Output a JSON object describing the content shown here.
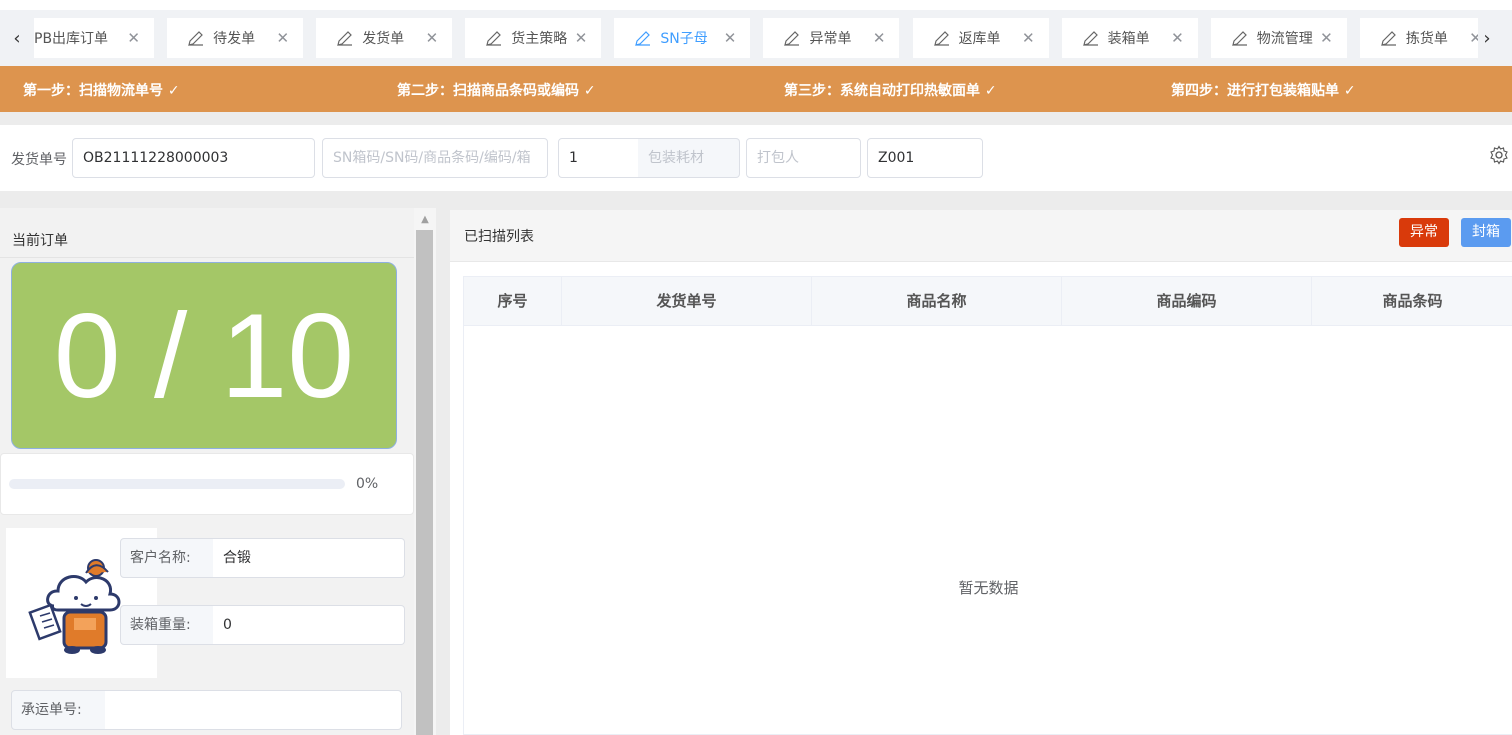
{
  "tabs": [
    {
      "label": "PB出库订单",
      "active": false
    },
    {
      "label": "待发单",
      "active": false
    },
    {
      "label": "发货单",
      "active": false
    },
    {
      "label": "货主策略",
      "active": false
    },
    {
      "label": "SN子母",
      "active": true
    },
    {
      "label": "异常单",
      "active": false
    },
    {
      "label": "返库单",
      "active": false
    },
    {
      "label": "装箱单",
      "active": false
    },
    {
      "label": "物流管理",
      "active": false
    },
    {
      "label": "拣货单",
      "active": false
    }
  ],
  "steps": [
    "第一步：扫描物流单号 ✓",
    "第二步：扫描商品条码或编码 ✓",
    "第三步：系统自动打印热敏面单 ✓",
    "第四步：进行打包装箱贴单 ✓"
  ],
  "form": {
    "order_label": "发货单号",
    "order_value": "OB21111228000003",
    "scan_placeholder": "SN箱码/SN码/商品条码/编码/箱",
    "qty_value": "1",
    "material_placeholder": "包装耗材",
    "packer_placeholder": "打包人",
    "code_value": "Z001"
  },
  "left": {
    "title": "当前订单",
    "counter": "0 / 10",
    "progress_percent": 0,
    "progress_text": "0%",
    "customer_label": "客户名称:",
    "customer_value": "合锻",
    "weight_label": "装箱重量:",
    "weight_value": "0",
    "tracking_label": "承运单号:",
    "tracking_value": ""
  },
  "right": {
    "title": "已扫描列表",
    "btn_abnormal": "异常",
    "btn_seal": "封箱",
    "columns": [
      "序号",
      "发货单号",
      "商品名称",
      "商品编码",
      "商品条码"
    ],
    "empty_text": "暂无数据"
  },
  "colors": {
    "steps_bar": "#dd944e",
    "counter_bg": "#a4c767",
    "active_tab": "#409eff",
    "btn_abnormal": "#d93a0b",
    "btn_seal": "#5b9bf0"
  }
}
